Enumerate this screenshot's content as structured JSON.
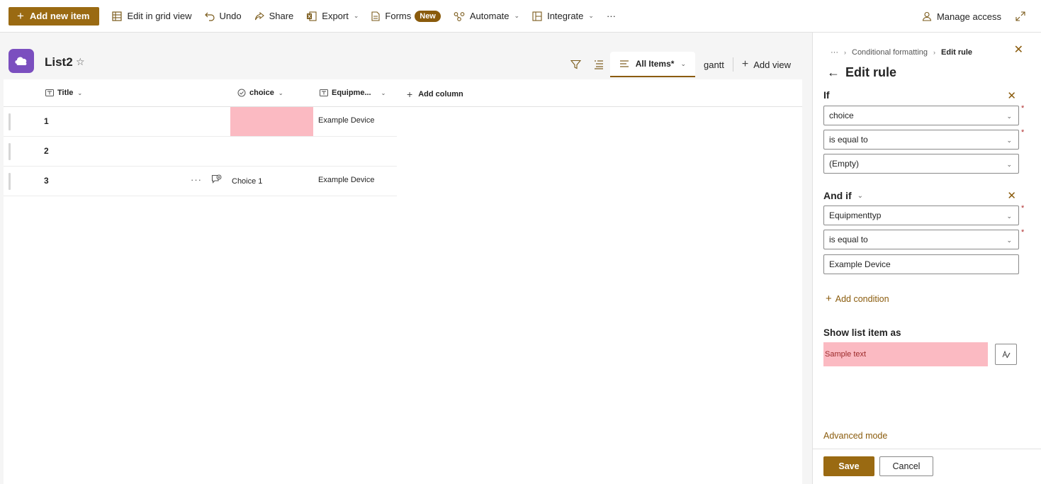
{
  "command_bar": {
    "add_new_item": "Add new item",
    "edit_grid": "Edit in grid view",
    "undo": "Undo",
    "share": "Share",
    "export": "Export",
    "forms": "Forms",
    "forms_badge": "New",
    "automate": "Automate",
    "integrate": "Integrate",
    "more": "···",
    "manage_access": "Manage access"
  },
  "list": {
    "title": "List2",
    "views": {
      "active": "All Items*",
      "gantt": "gantt",
      "add_view": "Add view"
    }
  },
  "grid": {
    "columns": {
      "title": "Title",
      "choice": "choice",
      "equipment": "Equipme...",
      "add_column": "Add column"
    },
    "rows": [
      {
        "title": "1",
        "choice": "",
        "equipment": "Example Device"
      },
      {
        "title": "2",
        "choice": "",
        "equipment": ""
      },
      {
        "title": "3",
        "choice": "Choice 1",
        "equipment": "Example Device"
      }
    ],
    "row_more": "···"
  },
  "panel": {
    "breadcrumb": {
      "ellipsis": "···",
      "parent": "Conditional formatting",
      "current": "Edit rule"
    },
    "title": "Edit rule",
    "if_label": "If",
    "condition1": {
      "field": "choice",
      "operator": "is equal to",
      "value": "(Empty)"
    },
    "and_if_label": "And if",
    "condition2": {
      "field": "Equipmenttyp",
      "operator": "is equal to",
      "value": "Example Device"
    },
    "add_condition": "Add condition",
    "show_as_label": "Show list item as",
    "sample_text": "Sample text",
    "advanced_mode": "Advanced mode",
    "save": "Save",
    "cancel": "Cancel",
    "required_mark": "*"
  },
  "colors": {
    "accent": "#9a6a12",
    "highlight": "#fbbac2",
    "list_icon": "#7b4fbf"
  }
}
